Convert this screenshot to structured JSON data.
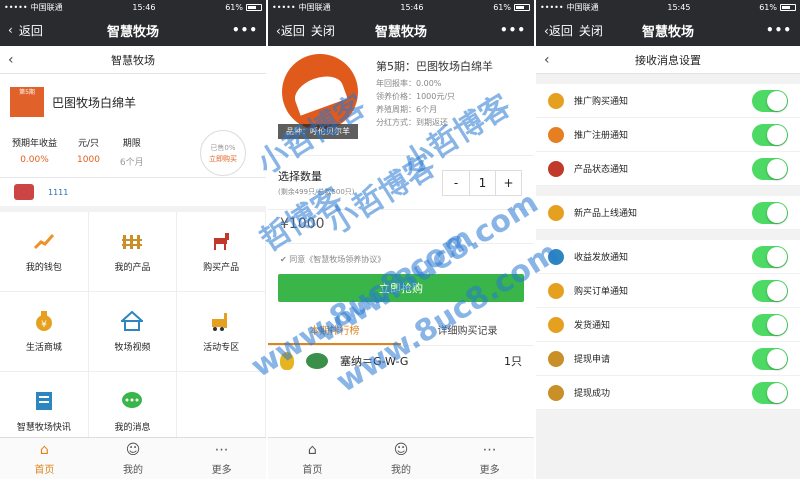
{
  "status": {
    "carrier": "中国联通",
    "time": "15:46",
    "time2": "15:45",
    "battery": "61%"
  },
  "panel1": {
    "nav": {
      "back": "返回",
      "title": "智慧牧场",
      "more": "•••"
    },
    "page_title": "智慧牧场",
    "product": {
      "tag": "第5期",
      "name": "巴图牧场白绵羊",
      "stats": [
        {
          "label": "预期年收益",
          "value": "0.00%"
        },
        {
          "label": "元/只",
          "value": "1000"
        },
        {
          "label": "期限",
          "value": "6个月"
        }
      ],
      "circle_line1": "已售0%",
      "circle_line2": "立即购买"
    },
    "user_id": "1111",
    "grid": [
      {
        "label": "我的钱包",
        "icon": "chart-up-icon",
        "color": "#f0902a"
      },
      {
        "label": "我的产品",
        "icon": "fence-icon",
        "color": "#c9902a"
      },
      {
        "label": "购买产品",
        "icon": "horse-icon",
        "color": "#c0392b"
      },
      {
        "label": "生活商城",
        "icon": "money-bag-icon",
        "color": "#e6a020"
      },
      {
        "label": "牧场视频",
        "icon": "house-icon",
        "color": "#2e86c1"
      },
      {
        "label": "活动专区",
        "icon": "forklift-icon",
        "color": "#e6a020"
      },
      {
        "label": "智慧牧场快讯",
        "icon": "newspaper-icon",
        "color": "#2e86c1"
      },
      {
        "label": "我的消息",
        "icon": "chat-icon",
        "color": "#39b54a"
      }
    ],
    "tabs": [
      "首页",
      "我的",
      "更多"
    ]
  },
  "panel2": {
    "nav": {
      "back": "返回",
      "close": "关闭",
      "title": "智慧牧场",
      "more": "•••"
    },
    "breed_tag": "品种：呼伦贝尔羊",
    "title": "第5期：巴图牧场白绵羊",
    "info": [
      "年回报率：0.00%",
      "领养价格：1000元/只",
      "养殖周期：6个月",
      "分红方式：到期返还"
    ],
    "qty_label": "选择数量",
    "qty_sub": "(剩余499只/总数500只)",
    "qty_value": "1",
    "minus": "-",
    "plus": "+",
    "price": "¥1000",
    "agreement": "同意《智慧牧场领养协议》",
    "buy_button": "立即抢购",
    "rank_tabs": [
      "本期排行榜",
      "详细购买记录"
    ],
    "rank": [
      {
        "name": "塞纳＝G-W-G",
        "count": "1只"
      }
    ],
    "tabs": [
      "首页",
      "我的",
      "更多"
    ]
  },
  "panel3": {
    "nav": {
      "back": "返回",
      "close": "关闭",
      "title": "智慧牧场",
      "more": "•••"
    },
    "page_title": "接收消息设置",
    "groups": [
      [
        {
          "label": "推广购买通知",
          "color": "#e6a020"
        },
        {
          "label": "推广注册通知",
          "color": "#e67e22"
        },
        {
          "label": "产品状态通知",
          "color": "#c0392b"
        }
      ],
      [
        {
          "label": "新产品上线通知",
          "color": "#e6a020"
        }
      ],
      [
        {
          "label": "收益发放通知",
          "color": "#2e86c1"
        },
        {
          "label": "购买订单通知",
          "color": "#e6a020"
        },
        {
          "label": "发货通知",
          "color": "#e6a020"
        },
        {
          "label": "提现申请",
          "color": "#c9902a"
        },
        {
          "label": "提现成功",
          "color": "#c9902a"
        }
      ]
    ]
  },
  "watermark": [
    "小哲博客",
    "小哲博客",
    "哲博客",
    "www.8uc8.com",
    "www.8uc8.com",
    "www.8uc8.com",
    "小哲博客"
  ]
}
